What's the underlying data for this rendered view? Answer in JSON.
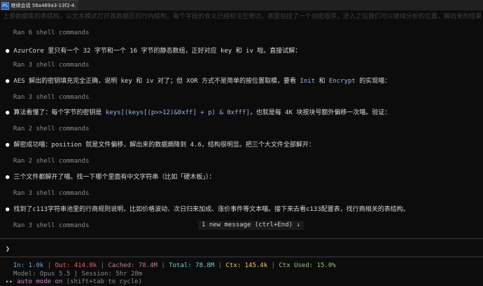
{
  "tab": {
    "icon_text": "PS",
    "title": "继续会话 56a469a3-13f2-4..."
  },
  "overflow_text": "上游数据库的表结构，以文本模式打开其数据区的行内结构，每个字段的含义已经标注在旁边，表里包括了一个加密程序，进入之后我们可以继续分析的位置，解出来的结果",
  "lines": {
    "run1": "Ran 6 shell commands",
    "msg1": "AzurCore 里只有一个 32 字节和一个 16 字节的静态数组，正好对应 key 和 iv 啦。直接试解：",
    "run2": "Ran 3 shell commands",
    "msg2_pre": "AES 解出的密钥填充完全正确，说明 key 和 iv 对了；但 XOR 方式不是简单的按位置取模，要看 ",
    "msg2_code1": "Init",
    "msg2_mid": " 和 ",
    "msg2_code2": "Encrypt",
    "msg2_post": " 的实现喵：",
    "run3": "Ran 3 shell commands",
    "msg3_pre": "算法看懂了：每个字节的密钥是 ",
    "msg3_code": "keys[(keys[(p>>12)&0xff] + p) & 0xfff]",
    "msg3_post": "，也就是每 4K 块按块号额外偏移一次喵。验证：",
    "run4": "Ran 2 shell commands",
    "msg4": "解密成功喵：position 就是文件偏移，解出来的数据熵降到 4.6，结构很明显。把三个大文件全部解开：",
    "run5": "Ran 2 shell commands",
    "msg5": "三个文件都解开了喵。找一下哪个里面有中文字符串（比如「硬木板」）：",
    "run6": "Ran 3 shell commands",
    "msg6": "找到了c113字符串池里的行商规则说明，比如价格波动、次日归来加成、涨价事件等文本喵。接下来去看c133配置表，找行商相关的表结构。",
    "run7": "Ran 3 shell commands"
  },
  "new_message_pill": "1 new message (ctrl+End) ↓",
  "prompt_symbol": "❯",
  "status": {
    "in_label": "In: 1.0k",
    "out_label": "Out: 414.8k",
    "cached_label": "Cached: 78.4M",
    "total_label": "Total: 78.8M",
    "ctx_label": "Ctx: 145.4k",
    "ctx_used_label": "Ctx Used: 15.0%",
    "sep": "|",
    "model_line": "Model: Opus 5.5 | Session: 5hr 28m",
    "auto_marker": "▸▸",
    "auto_mode": "auto mode on",
    "auto_hint": "(shift+tab to cycle)"
  }
}
